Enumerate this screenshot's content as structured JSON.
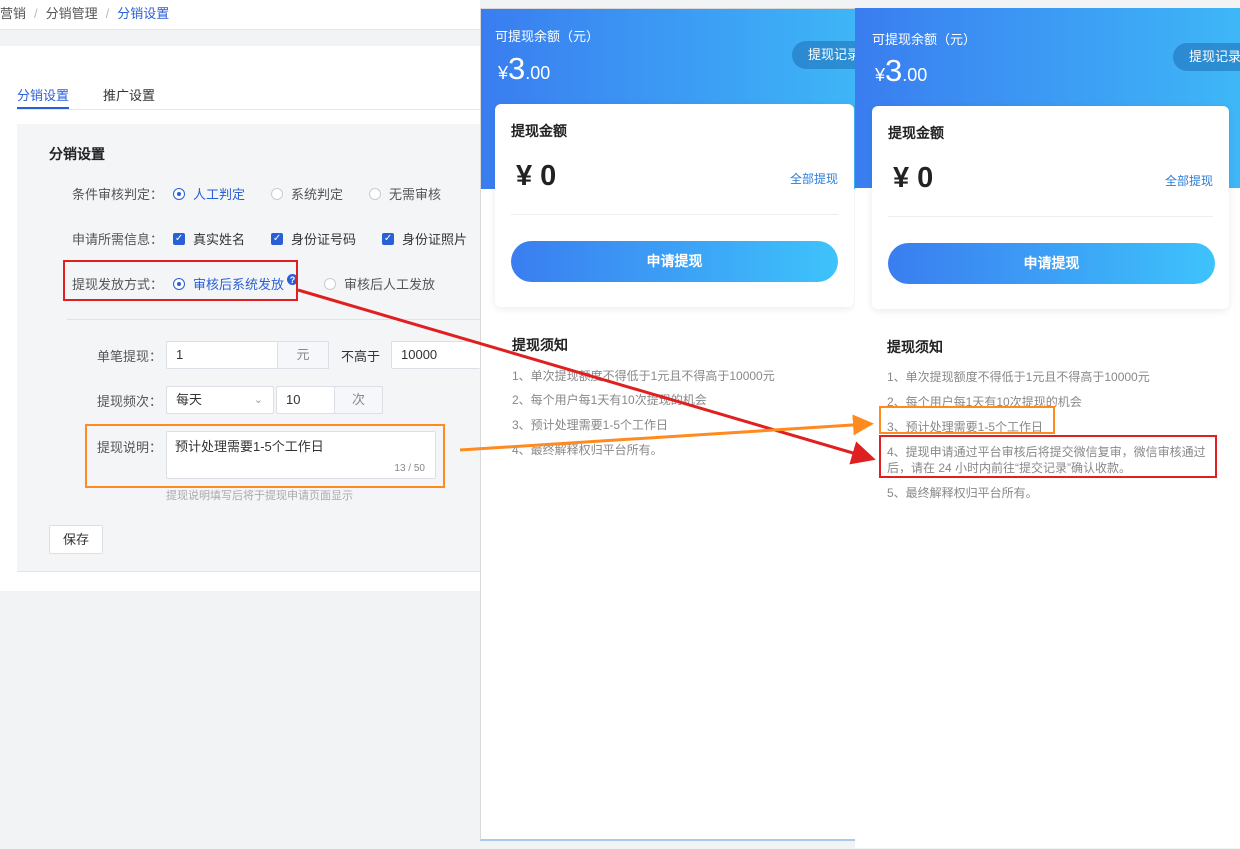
{
  "breadcrumb": [
    "营销",
    "分销管理",
    "分销设置"
  ],
  "tabs": [
    "分销设置",
    "推广设置"
  ],
  "panel": {
    "title": "分销设置",
    "audit": {
      "label": "条件审核判定：",
      "options": [
        "人工判定",
        "系统判定",
        "无需审核"
      ],
      "selected": "人工判定"
    },
    "info": {
      "label": "申请所需信息：",
      "options": [
        "真实姓名",
        "身份证号码",
        "身份证照片"
      ]
    },
    "payout": {
      "label": "提现发放方式：",
      "options": [
        "审核后系统发放",
        "审核后人工发放"
      ],
      "selected": "审核后系统发放",
      "help": "?"
    },
    "single": {
      "label": "单笔提现：",
      "min": "1",
      "unit": "元",
      "max_label": "不高于",
      "max": "10000"
    },
    "freq": {
      "label": "提现频次：",
      "period": "每天",
      "count": "10",
      "unit": "次"
    },
    "desc": {
      "label": "提现说明：",
      "value": "预计处理需要1-5个工作日",
      "counter": "13 / 50",
      "hint": "提现说明填写后将于提现申请页面显示"
    },
    "save": "保存"
  },
  "phone1": {
    "balance_label": "可提现余额（元）",
    "yen": "¥",
    "balance_int": "3",
    "balance_dec": ".00",
    "record": "提现记录",
    "card_title": "提现金额",
    "amount": "¥ 0",
    "all": "全部提现",
    "apply": "申请提现",
    "notice_title": "提现须知",
    "notices": [
      "1、单次提现额度不得低于1元且不得高于10000元",
      "2、每个用户每1天有10次提现的机会",
      "3、预计处理需要1-5个工作日",
      "4、最终解释权归平台所有。"
    ]
  },
  "phone2": {
    "balance_label": "可提现余额（元）",
    "yen": "¥",
    "balance_int": "3",
    "balance_dec": ".00",
    "record": "提现记录",
    "card_title": "提现金额",
    "amount": "¥ 0",
    "all": "全部提现",
    "apply": "申请提现",
    "notice_title": "提现须知",
    "notices": [
      "1、单次提现额度不得低于1元且不得高于10000元",
      "2、每个用户每1天有10次提现的机会",
      "3、预计处理需要1-5个工作日",
      "4、提现申请通过平台审核后将提交微信复审，微信审核通过后，请在 24 小时内前往“提交记录”确认收款。",
      "5、最终解释权归平台所有。"
    ]
  },
  "colors": {
    "primary": "#2b5fd6",
    "highlight_red": "#e02020",
    "highlight_orange": "#ff8a1f",
    "header_from": "#3a7df0",
    "header_to": "#3eb7f7"
  }
}
